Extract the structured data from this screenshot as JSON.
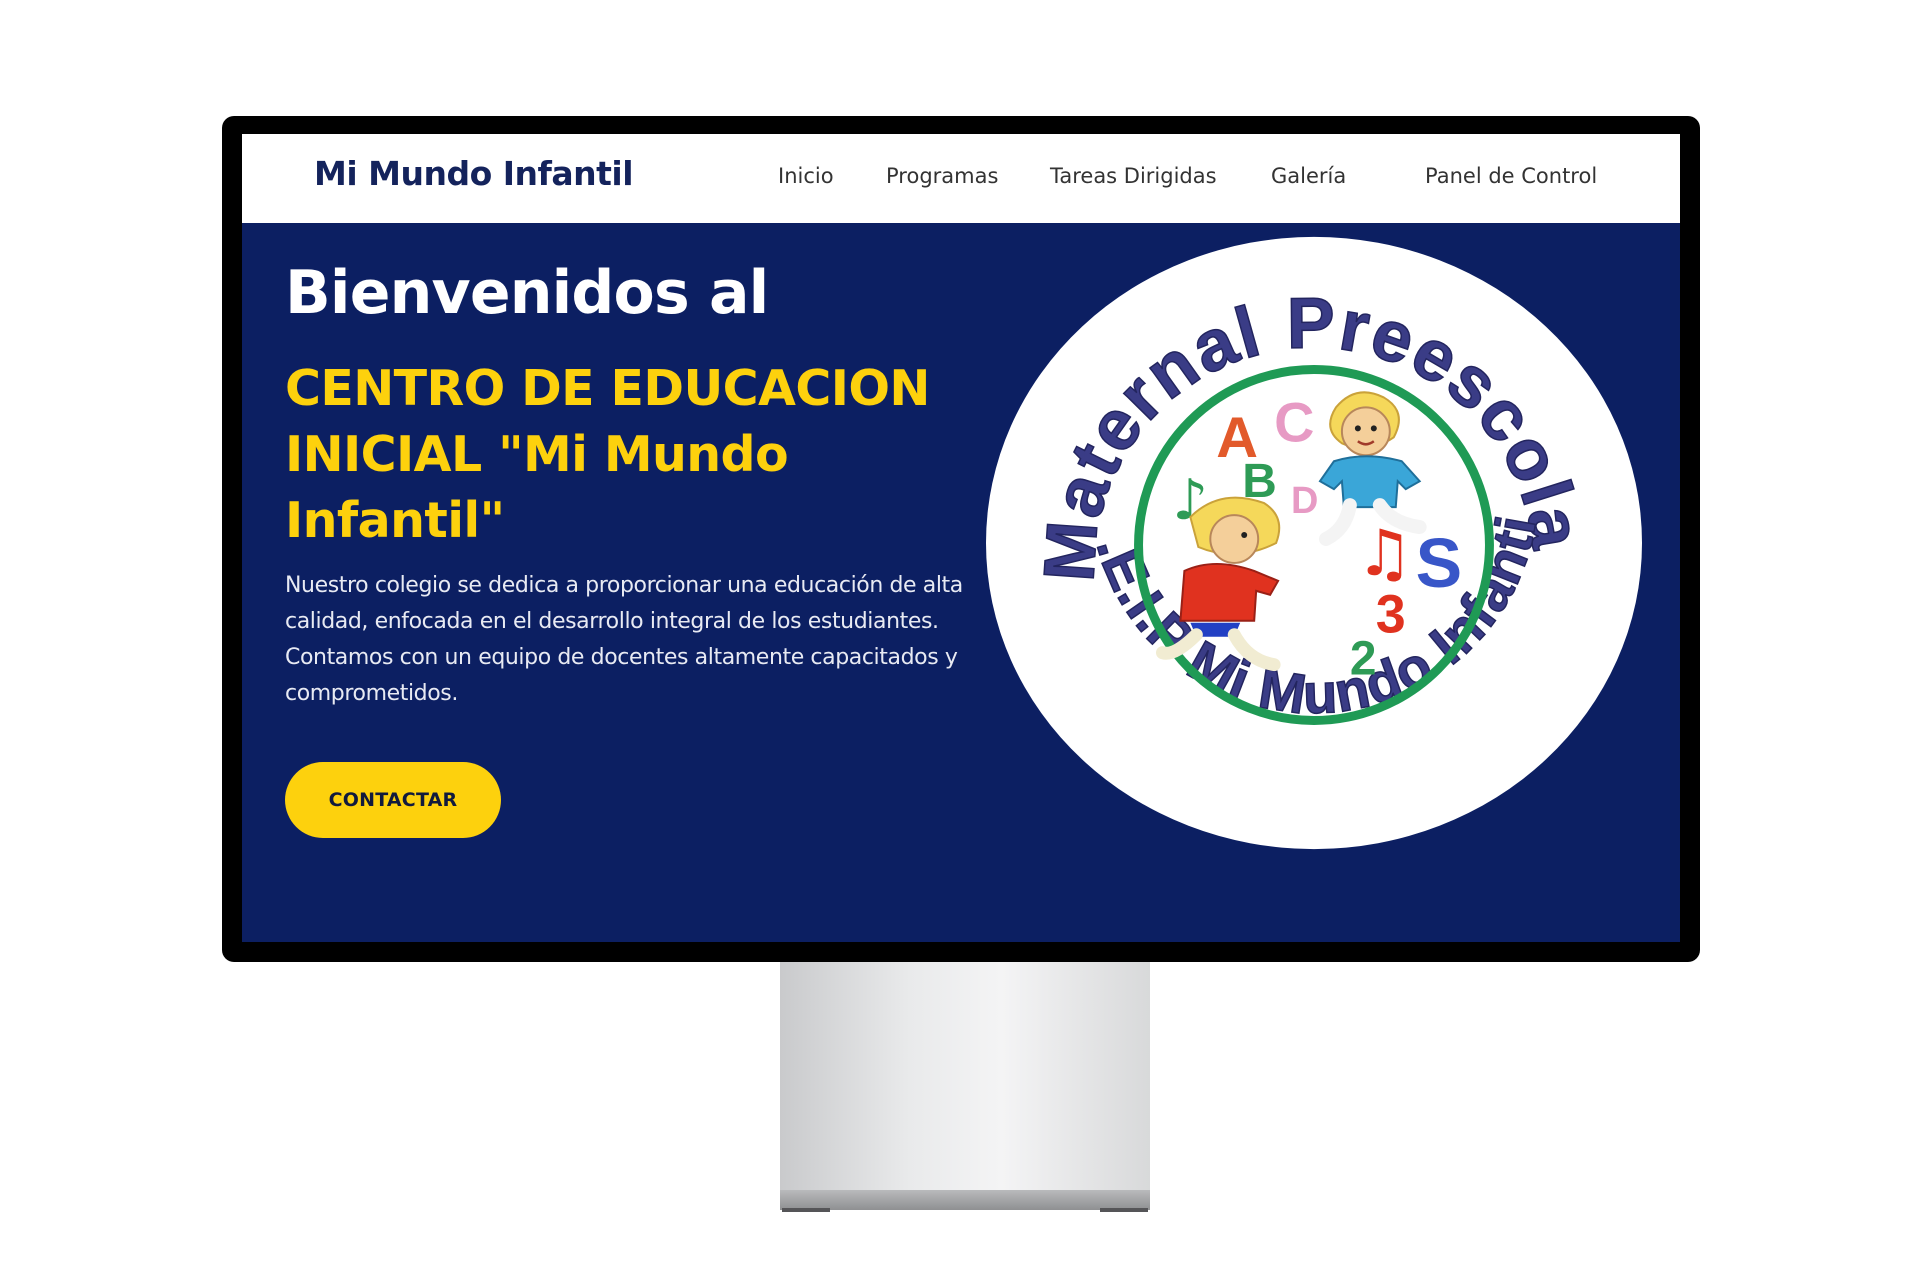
{
  "site": {
    "brand": "Mi Mundo Infantil"
  },
  "nav": {
    "items": [
      {
        "label": "Inicio"
      },
      {
        "label": "Programas"
      },
      {
        "label": "Tareas Dirigidas"
      },
      {
        "label": "Galería"
      },
      {
        "label": "Panel de Control"
      }
    ]
  },
  "hero": {
    "title": "Bienvenidos al",
    "subtitle": "CENTRO DE EDUCACION INICIAL \"Mi Mundo Infantil\"",
    "description": "Nuestro colegio se dedica a proporcionar una educación de alta calidad, enfocada en el desarrollo integral de los estudiantes. Contamos con un equipo de docentes altamente capacitados y comprometidos.",
    "cta_label": "CONTACTAR"
  },
  "logo": {
    "top_text": "Maternal Preescolar",
    "bottom_text": "C.E.I.P Mi Mundo Infantil",
    "icon": "school-emblem-icon"
  },
  "colors": {
    "nav_bg": "#ffffff",
    "hero_bg": "#0c1f62",
    "accent_yellow": "#fdd10d",
    "brand_text": "#14235c",
    "logo_text": "#3a3c86",
    "logo_ring": "#1f9a55"
  }
}
